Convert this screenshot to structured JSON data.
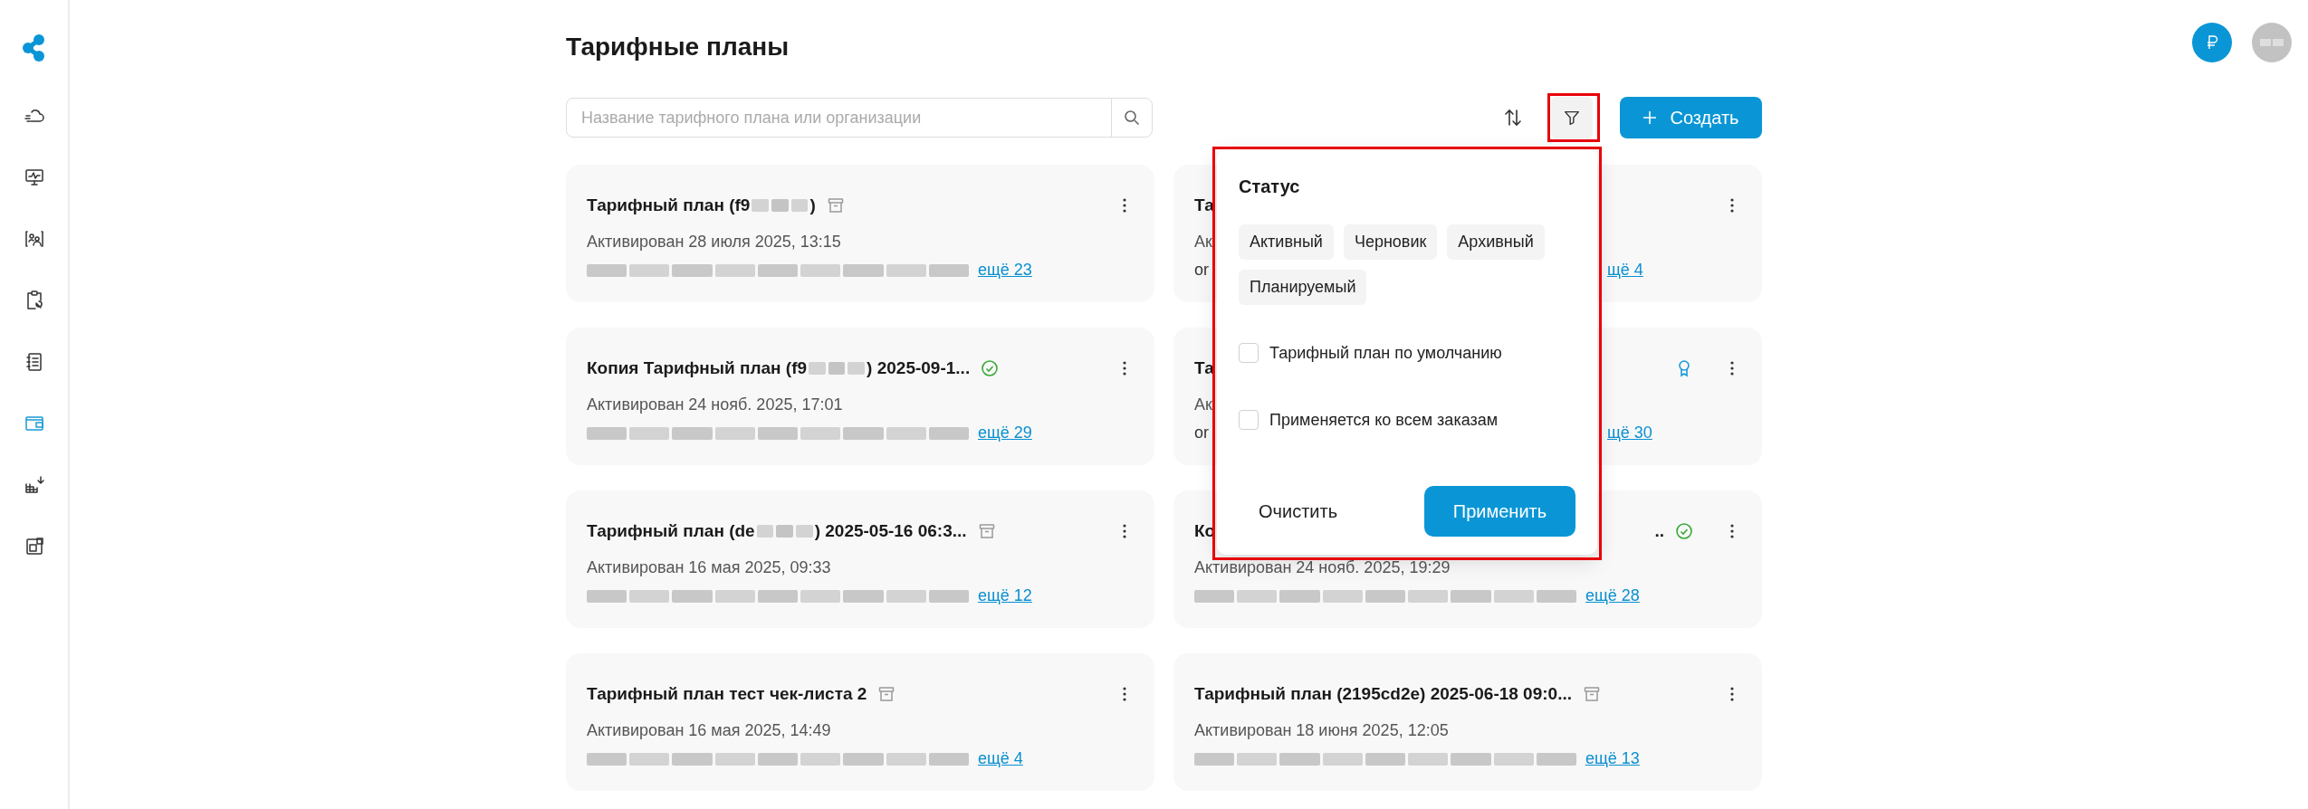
{
  "sidebar": {
    "items": [
      {
        "selected": false
      },
      {
        "selected": false
      },
      {
        "selected": false
      },
      {
        "selected": false
      },
      {
        "selected": false
      },
      {
        "selected": true
      },
      {
        "selected": false
      },
      {
        "selected": false
      }
    ]
  },
  "title": "Тарифные планы",
  "search": {
    "placeholder": "Название тарифного плана или организации"
  },
  "filter_button": {
    "highlighted": true
  },
  "create_button": {
    "label": "Создать"
  },
  "cards": [
    {
      "kind": "archived",
      "title": "Тарифный план (f9",
      "redacted": true,
      "title_end": ")",
      "date": "Активирован 28 июля 2025, 13:15",
      "orgs_redacted": true,
      "more": "ещё 23"
    },
    {
      "kind": "plain",
      "title": "Та",
      "date": "Ак",
      "orgs": "or",
      "more": "щё 4"
    },
    {
      "kind": "active",
      "title": "Копия Тарифный план (f9",
      "redacted": true,
      "title_end": ") 2025-09-1...",
      "date": "Активирован 24 нояб. 2025, 17:01",
      "orgs_redacted": true,
      "more": "ещё 29"
    },
    {
      "kind": "default",
      "title": "Та",
      "date": "Ак",
      "orgs": "or",
      "more": "щё 30"
    },
    {
      "kind": "archived",
      "title": "Тарифный план (de",
      "redacted": true,
      "title_end": ") 2025-05-16 06:3...",
      "date": "Активирован 16 мая 2025, 09:33",
      "orgs_redacted": true,
      "more": "ещё 12"
    },
    {
      "kind": "active",
      "title": "Ко",
      "title_end": "..",
      "date": "Активирован 24 нояб. 2025, 19:29",
      "orgs_redacted": true,
      "more": "ещё 28"
    },
    {
      "kind": "archived",
      "title": "Тарифный план тест чек-листа 2",
      "date": "Активирован 16 мая 2025, 14:49",
      "orgs_redacted": true,
      "more": "ещё 4"
    },
    {
      "kind": "archived",
      "title": "Тарифный план (2195cd2e) 2025-06-18 09:0...",
      "date": "Активирован 18 июня 2025, 12:05",
      "orgs_redacted": true,
      "more": "ещё 13"
    }
  ],
  "filter_popup": {
    "highlighted": true,
    "heading": "Статус",
    "chips": [
      {
        "label": "Активный",
        "selected": false
      },
      {
        "label": "Черновик",
        "selected": false
      },
      {
        "label": "Архивный",
        "selected": false
      },
      {
        "label": "Планируемый",
        "selected": false
      }
    ],
    "checkboxes": [
      {
        "label": "Тарифный план по умолчанию",
        "checked": false
      },
      {
        "label": "Применяется ко всем заказам",
        "checked": false
      }
    ],
    "clear_button": "Очистить",
    "apply_button": "Применить"
  }
}
